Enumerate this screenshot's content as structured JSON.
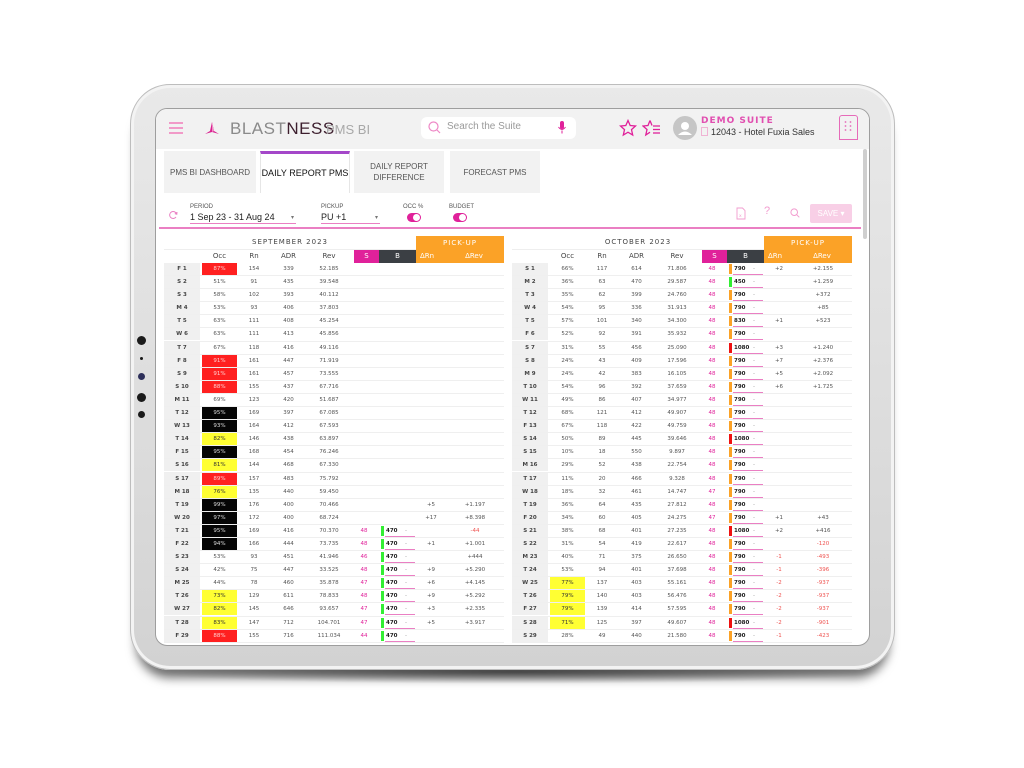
{
  "app": {
    "brand_prefix": "BLAST",
    "brand_suffix": "NESS",
    "product": "PMS BI",
    "search_placeholder": "Search the Suite",
    "suite_name": "DEMO SUITE",
    "hotel": "12043 - Hotel Fuxia Sales",
    "icons": [
      "menu-icon",
      "logo-icon",
      "search-icon",
      "mic-icon",
      "star-icon",
      "star-list-icon",
      "avatar-icon",
      "building-icon"
    ]
  },
  "tabs": [
    {
      "label": "PMS BI DASHBOARD",
      "active": false
    },
    {
      "label": "DAILY REPORT PMS",
      "active": true
    },
    {
      "label": "DAILY REPORT DIFFERENCE",
      "active": false
    },
    {
      "label": "FORECAST PMS",
      "active": false
    }
  ],
  "filters": {
    "period_label": "PERIOD",
    "period_value": "1 Sep 23 - 31 Aug 24",
    "pickup_label": "PICKUP",
    "pickup_value": "PU +1",
    "occ_label": "OCC %",
    "occ_on": true,
    "budget_label": "BUDGET",
    "budget_on": true,
    "help_label": "?",
    "save_label": "SAVE ▾"
  },
  "colors": {
    "accent": "#e0219a",
    "pickup": "#fba227",
    "budget_header": "#3b3f44",
    "occ_red": "#ff2020",
    "occ_black": "#050505",
    "occ_yellow": "#ffff33",
    "bar_green": "#33ee33",
    "bar_orange": "#fba227",
    "bar_red": "#ee1111"
  },
  "table_headers": {
    "occ": "Occ",
    "rn": "Rn",
    "adr": "ADR",
    "rev": "Rev",
    "s": "S",
    "b": "B",
    "pickup": "PICK-UP",
    "drn": "ΔRn",
    "drev": "ΔRev"
  },
  "months": [
    {
      "title": "SEPTEMBER 2023",
      "rows": [
        {
          "day": "F 1",
          "occ": "87%",
          "hl": "red",
          "rn": "154",
          "adr": "339",
          "rev": "52.185",
          "s": "",
          "b": "",
          "bar": "",
          "drn": "",
          "drev": ""
        },
        {
          "day": "S 2",
          "occ": "51%",
          "hl": "",
          "rn": "91",
          "adr": "435",
          "rev": "39.548",
          "s": "",
          "b": "",
          "bar": "",
          "drn": "",
          "drev": ""
        },
        {
          "day": "S 3",
          "occ": "58%",
          "hl": "",
          "rn": "102",
          "adr": "393",
          "rev": "40.112",
          "s": "",
          "b": "",
          "bar": "",
          "drn": "",
          "drev": ""
        },
        {
          "day": "M 4",
          "occ": "53%",
          "hl": "",
          "rn": "93",
          "adr": "406",
          "rev": "37.803",
          "s": "",
          "b": "",
          "bar": "",
          "drn": "",
          "drev": ""
        },
        {
          "day": "T 5",
          "occ": "63%",
          "hl": "",
          "rn": "111",
          "adr": "408",
          "rev": "45.254",
          "s": "",
          "b": "",
          "bar": "",
          "drn": "",
          "drev": ""
        },
        {
          "day": "W 6",
          "occ": "63%",
          "hl": "",
          "rn": "111",
          "adr": "413",
          "rev": "45.856",
          "s": "",
          "b": "",
          "bar": "",
          "drn": "",
          "drev": ""
        },
        {
          "day": "T 7",
          "occ": "67%",
          "hl": "",
          "rn": "118",
          "adr": "416",
          "rev": "49.116",
          "s": "",
          "b": "",
          "bar": "",
          "drn": "",
          "drev": ""
        },
        {
          "day": "F 8",
          "occ": "91%",
          "hl": "red",
          "rn": "161",
          "adr": "447",
          "rev": "71.919",
          "s": "",
          "b": "",
          "bar": "",
          "drn": "",
          "drev": ""
        },
        {
          "day": "S 9",
          "occ": "91%",
          "hl": "red",
          "rn": "161",
          "adr": "457",
          "rev": "73.555",
          "s": "",
          "b": "",
          "bar": "",
          "drn": "",
          "drev": ""
        },
        {
          "day": "S 10",
          "occ": "88%",
          "hl": "red",
          "rn": "155",
          "adr": "437",
          "rev": "67.716",
          "s": "",
          "b": "",
          "bar": "",
          "drn": "",
          "drev": ""
        },
        {
          "day": "M 11",
          "occ": "69%",
          "hl": "",
          "rn": "123",
          "adr": "420",
          "rev": "51.687",
          "s": "",
          "b": "",
          "bar": "",
          "drn": "",
          "drev": ""
        },
        {
          "day": "T 12",
          "occ": "95%",
          "hl": "black",
          "rn": "169",
          "adr": "397",
          "rev": "67.085",
          "s": "",
          "b": "",
          "bar": "",
          "drn": "",
          "drev": ""
        },
        {
          "day": "W 13",
          "occ": "93%",
          "hl": "black",
          "rn": "164",
          "adr": "412",
          "rev": "67.593",
          "s": "",
          "b": "",
          "bar": "",
          "drn": "",
          "drev": ""
        },
        {
          "day": "T 14",
          "occ": "82%",
          "hl": "yellow",
          "rn": "146",
          "adr": "438",
          "rev": "63.897",
          "s": "",
          "b": "",
          "bar": "",
          "drn": "",
          "drev": ""
        },
        {
          "day": "F 15",
          "occ": "95%",
          "hl": "black",
          "rn": "168",
          "adr": "454",
          "rev": "76.246",
          "s": "",
          "b": "",
          "bar": "",
          "drn": "",
          "drev": ""
        },
        {
          "day": "S 16",
          "occ": "81%",
          "hl": "yellow",
          "rn": "144",
          "adr": "468",
          "rev": "67.330",
          "s": "",
          "b": "",
          "bar": "",
          "drn": "",
          "drev": ""
        },
        {
          "day": "S 17",
          "occ": "89%",
          "hl": "red",
          "rn": "157",
          "adr": "483",
          "rev": "75.792",
          "s": "",
          "b": "",
          "bar": "",
          "drn": "",
          "drev": ""
        },
        {
          "day": "M 18",
          "occ": "76%",
          "hl": "yellow",
          "rn": "135",
          "adr": "440",
          "rev": "59.450",
          "s": "",
          "b": "",
          "bar": "",
          "drn": "",
          "drev": ""
        },
        {
          "day": "T 19",
          "occ": "99%",
          "hl": "black",
          "rn": "176",
          "adr": "400",
          "rev": "70.466",
          "s": "",
          "b": "",
          "bar": "",
          "drn": "+5",
          "drev": "+1.197"
        },
        {
          "day": "W 20",
          "occ": "97%",
          "hl": "black",
          "rn": "172",
          "adr": "400",
          "rev": "68.724",
          "s": "",
          "b": "",
          "bar": "",
          "drn": "+17",
          "drev": "+8.398"
        },
        {
          "day": "T 21",
          "occ": "95%",
          "hl": "black",
          "rn": "169",
          "adr": "416",
          "rev": "70.370",
          "s": "48",
          "b": "470",
          "bar": "green",
          "drn": "",
          "drev": "-44"
        },
        {
          "day": "F 22",
          "occ": "94%",
          "hl": "black",
          "rn": "166",
          "adr": "444",
          "rev": "73.735",
          "s": "48",
          "b": "470",
          "bar": "green",
          "drn": "+1",
          "drev": "+1.001"
        },
        {
          "day": "S 23",
          "occ": "53%",
          "hl": "",
          "rn": "93",
          "adr": "451",
          "rev": "41.946",
          "s": "46",
          "b": "470",
          "bar": "green",
          "drn": "",
          "drev": "+444"
        },
        {
          "day": "S 24",
          "occ": "42%",
          "hl": "",
          "rn": "75",
          "adr": "447",
          "rev": "33.525",
          "s": "48",
          "b": "470",
          "bar": "green",
          "drn": "+9",
          "drev": "+5.290"
        },
        {
          "day": "M 25",
          "occ": "44%",
          "hl": "",
          "rn": "78",
          "adr": "460",
          "rev": "35.878",
          "s": "47",
          "b": "470",
          "bar": "green",
          "drn": "+6",
          "drev": "+4.145"
        },
        {
          "day": "T 26",
          "occ": "73%",
          "hl": "yellow",
          "rn": "129",
          "adr": "611",
          "rev": "78.833",
          "s": "48",
          "b": "470",
          "bar": "green",
          "drn": "+9",
          "drev": "+5.292"
        },
        {
          "day": "W 27",
          "occ": "82%",
          "hl": "yellow",
          "rn": "145",
          "adr": "646",
          "rev": "93.657",
          "s": "47",
          "b": "470",
          "bar": "green",
          "drn": "+3",
          "drev": "+2.335"
        },
        {
          "day": "T 28",
          "occ": "83%",
          "hl": "yellow",
          "rn": "147",
          "adr": "712",
          "rev": "104.701",
          "s": "47",
          "b": "470",
          "bar": "green",
          "drn": "+5",
          "drev": "+3.917"
        },
        {
          "day": "F 29",
          "occ": "88%",
          "hl": "red",
          "rn": "155",
          "adr": "716",
          "rev": "111.034",
          "s": "44",
          "b": "470",
          "bar": "green",
          "drn": "",
          "drev": ""
        }
      ]
    },
    {
      "title": "OCTOBER 2023",
      "rows": [
        {
          "day": "S 1",
          "occ": "66%",
          "hl": "",
          "rn": "117",
          "adr": "614",
          "rev": "71.806",
          "s": "48",
          "b": "790",
          "bar": "orange",
          "drn": "+2",
          "drev": "+2.155"
        },
        {
          "day": "M 2",
          "occ": "36%",
          "hl": "",
          "rn": "63",
          "adr": "470",
          "rev": "29.587",
          "s": "48",
          "b": "450",
          "bar": "green",
          "drn": "",
          "drev": "+1.259"
        },
        {
          "day": "T 3",
          "occ": "35%",
          "hl": "",
          "rn": "62",
          "adr": "399",
          "rev": "24.760",
          "s": "48",
          "b": "790",
          "bar": "orange",
          "drn": "",
          "drev": "+372"
        },
        {
          "day": "W 4",
          "occ": "54%",
          "hl": "",
          "rn": "95",
          "adr": "336",
          "rev": "31.913",
          "s": "48",
          "b": "790",
          "bar": "orange",
          "drn": "",
          "drev": "+85"
        },
        {
          "day": "T 5",
          "occ": "57%",
          "hl": "",
          "rn": "101",
          "adr": "340",
          "rev": "34.300",
          "s": "48",
          "b": "830",
          "bar": "orange",
          "drn": "+1",
          "drev": "+523"
        },
        {
          "day": "F 6",
          "occ": "52%",
          "hl": "",
          "rn": "92",
          "adr": "391",
          "rev": "35.932",
          "s": "48",
          "b": "790",
          "bar": "orange",
          "drn": "",
          "drev": ""
        },
        {
          "day": "S 7",
          "occ": "31%",
          "hl": "",
          "rn": "55",
          "adr": "456",
          "rev": "25.090",
          "s": "48",
          "b": "1080",
          "bar": "red",
          "drn": "+3",
          "drev": "+1.240"
        },
        {
          "day": "S 8",
          "occ": "24%",
          "hl": "",
          "rn": "43",
          "adr": "409",
          "rev": "17.596",
          "s": "48",
          "b": "790",
          "bar": "orange",
          "drn": "+7",
          "drev": "+2.376"
        },
        {
          "day": "M 9",
          "occ": "24%",
          "hl": "",
          "rn": "42",
          "adr": "383",
          "rev": "16.105",
          "s": "48",
          "b": "790",
          "bar": "orange",
          "drn": "+5",
          "drev": "+2.092"
        },
        {
          "day": "T 10",
          "occ": "54%",
          "hl": "",
          "rn": "96",
          "adr": "392",
          "rev": "37.659",
          "s": "48",
          "b": "790",
          "bar": "orange",
          "drn": "+6",
          "drev": "+1.725"
        },
        {
          "day": "W 11",
          "occ": "49%",
          "hl": "",
          "rn": "86",
          "adr": "407",
          "rev": "34.977",
          "s": "48",
          "b": "790",
          "bar": "orange",
          "drn": "",
          "drev": ""
        },
        {
          "day": "T 12",
          "occ": "68%",
          "hl": "",
          "rn": "121",
          "adr": "412",
          "rev": "49.907",
          "s": "48",
          "b": "790",
          "bar": "orange",
          "drn": "",
          "drev": ""
        },
        {
          "day": "F 13",
          "occ": "67%",
          "hl": "",
          "rn": "118",
          "adr": "422",
          "rev": "49.759",
          "s": "48",
          "b": "790",
          "bar": "orange",
          "drn": "",
          "drev": ""
        },
        {
          "day": "S 14",
          "occ": "50%",
          "hl": "",
          "rn": "89",
          "adr": "445",
          "rev": "39.646",
          "s": "48",
          "b": "1080",
          "bar": "red",
          "drn": "",
          "drev": ""
        },
        {
          "day": "S 15",
          "occ": "10%",
          "hl": "",
          "rn": "18",
          "adr": "550",
          "rev": "9.897",
          "s": "48",
          "b": "790",
          "bar": "orange",
          "drn": "",
          "drev": ""
        },
        {
          "day": "M 16",
          "occ": "29%",
          "hl": "",
          "rn": "52",
          "adr": "438",
          "rev": "22.754",
          "s": "48",
          "b": "790",
          "bar": "orange",
          "drn": "",
          "drev": ""
        },
        {
          "day": "T 17",
          "occ": "11%",
          "hl": "",
          "rn": "20",
          "adr": "466",
          "rev": "9.328",
          "s": "48",
          "b": "790",
          "bar": "orange",
          "drn": "",
          "drev": ""
        },
        {
          "day": "W 18",
          "occ": "18%",
          "hl": "",
          "rn": "32",
          "adr": "461",
          "rev": "14.747",
          "s": "47",
          "b": "790",
          "bar": "orange",
          "drn": "",
          "drev": ""
        },
        {
          "day": "T 19",
          "occ": "36%",
          "hl": "",
          "rn": "64",
          "adr": "435",
          "rev": "27.812",
          "s": "48",
          "b": "790",
          "bar": "orange",
          "drn": "",
          "drev": ""
        },
        {
          "day": "F 20",
          "occ": "34%",
          "hl": "",
          "rn": "60",
          "adr": "405",
          "rev": "24.275",
          "s": "47",
          "b": "790",
          "bar": "orange",
          "drn": "+1",
          "drev": "+43"
        },
        {
          "day": "S 21",
          "occ": "38%",
          "hl": "",
          "rn": "68",
          "adr": "401",
          "rev": "27.235",
          "s": "48",
          "b": "1080",
          "bar": "red",
          "drn": "+2",
          "drev": "+416"
        },
        {
          "day": "S 22",
          "occ": "31%",
          "hl": "",
          "rn": "54",
          "adr": "419",
          "rev": "22.617",
          "s": "48",
          "b": "790",
          "bar": "orange",
          "drn": "",
          "drev": "-120"
        },
        {
          "day": "M 23",
          "occ": "40%",
          "hl": "",
          "rn": "71",
          "adr": "375",
          "rev": "26.650",
          "s": "48",
          "b": "790",
          "bar": "orange",
          "drn": "-1",
          "drev": "-493"
        },
        {
          "day": "T 24",
          "occ": "53%",
          "hl": "",
          "rn": "94",
          "adr": "401",
          "rev": "37.698",
          "s": "48",
          "b": "790",
          "bar": "orange",
          "drn": "-1",
          "drev": "-396"
        },
        {
          "day": "W 25",
          "occ": "77%",
          "hl": "yellow",
          "rn": "137",
          "adr": "403",
          "rev": "55.161",
          "s": "48",
          "b": "790",
          "bar": "orange",
          "drn": "-2",
          "drev": "-937"
        },
        {
          "day": "T 26",
          "occ": "79%",
          "hl": "yellow",
          "rn": "140",
          "adr": "403",
          "rev": "56.476",
          "s": "48",
          "b": "790",
          "bar": "orange",
          "drn": "-2",
          "drev": "-937"
        },
        {
          "day": "F 27",
          "occ": "79%",
          "hl": "yellow",
          "rn": "139",
          "adr": "414",
          "rev": "57.595",
          "s": "48",
          "b": "790",
          "bar": "orange",
          "drn": "-2",
          "drev": "-937"
        },
        {
          "day": "S 28",
          "occ": "71%",
          "hl": "yellow",
          "rn": "125",
          "adr": "397",
          "rev": "49.607",
          "s": "48",
          "b": "1080",
          "bar": "red",
          "drn": "-2",
          "drev": "-901"
        },
        {
          "day": "S 29",
          "occ": "28%",
          "hl": "",
          "rn": "49",
          "adr": "440",
          "rev": "21.580",
          "s": "48",
          "b": "790",
          "bar": "orange",
          "drn": "-1",
          "drev": "-423"
        }
      ]
    }
  ]
}
